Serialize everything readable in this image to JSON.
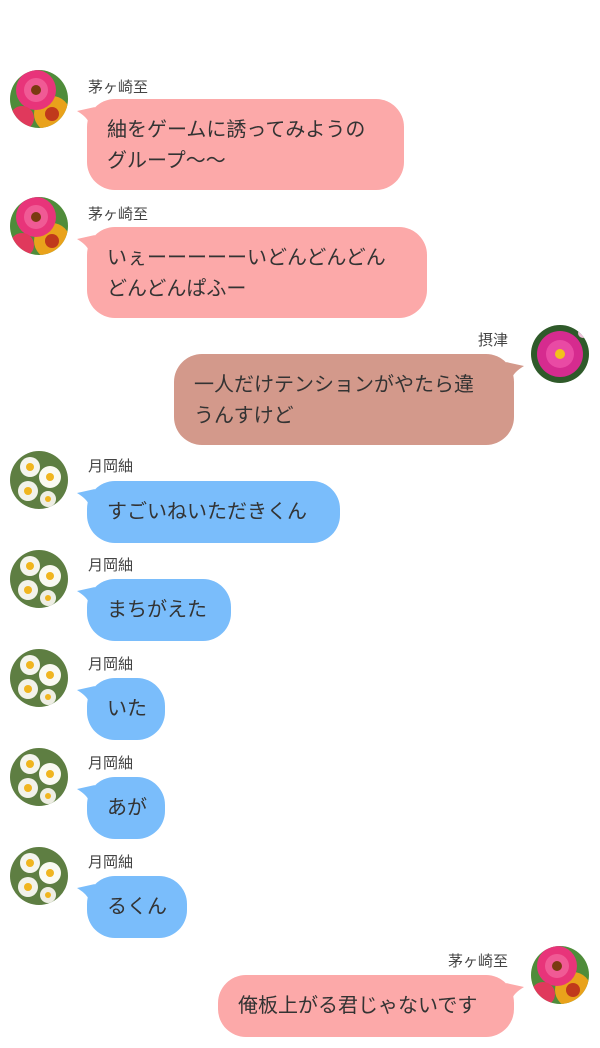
{
  "colors": {
    "pink_bubble": "#fca9a9",
    "brown_bubble": "#d3998b",
    "blue_bubble": "#7abdfb",
    "background": "#ffffff"
  },
  "users": {
    "itaru": {
      "name": "茅ヶ崎至",
      "avatar_icon": "pink-gerbera-avatar"
    },
    "settsu": {
      "name": "摂津",
      "avatar_icon": "pink-cosmos-avatar"
    },
    "tsumugi": {
      "name": "月岡紬",
      "avatar_icon": "white-daffodil-avatar"
    }
  },
  "messages": [
    {
      "sender": "茅ヶ崎至",
      "lines": [
        "紬をゲームに誘ってみようの",
        "グループ〜〜"
      ]
    },
    {
      "sender": "茅ヶ崎至",
      "lines": [
        "いぇーーーーーいどんどんどん",
        "どんどんぱふー"
      ]
    },
    {
      "sender": "摂津",
      "lines": [
        "一人だけテンションがやたら違",
        "うんすけど"
      ]
    },
    {
      "sender": "月岡紬",
      "lines": [
        "すごいねいただきくん"
      ]
    },
    {
      "sender": "月岡紬",
      "lines": [
        "まちがえた"
      ]
    },
    {
      "sender": "月岡紬",
      "lines": [
        "いた"
      ]
    },
    {
      "sender": "月岡紬",
      "lines": [
        "あが"
      ]
    },
    {
      "sender": "月岡紬",
      "lines": [
        "るくん"
      ]
    },
    {
      "sender": "茅ヶ崎至",
      "lines": [
        "俺板上がる君じゃないです"
      ]
    }
  ]
}
